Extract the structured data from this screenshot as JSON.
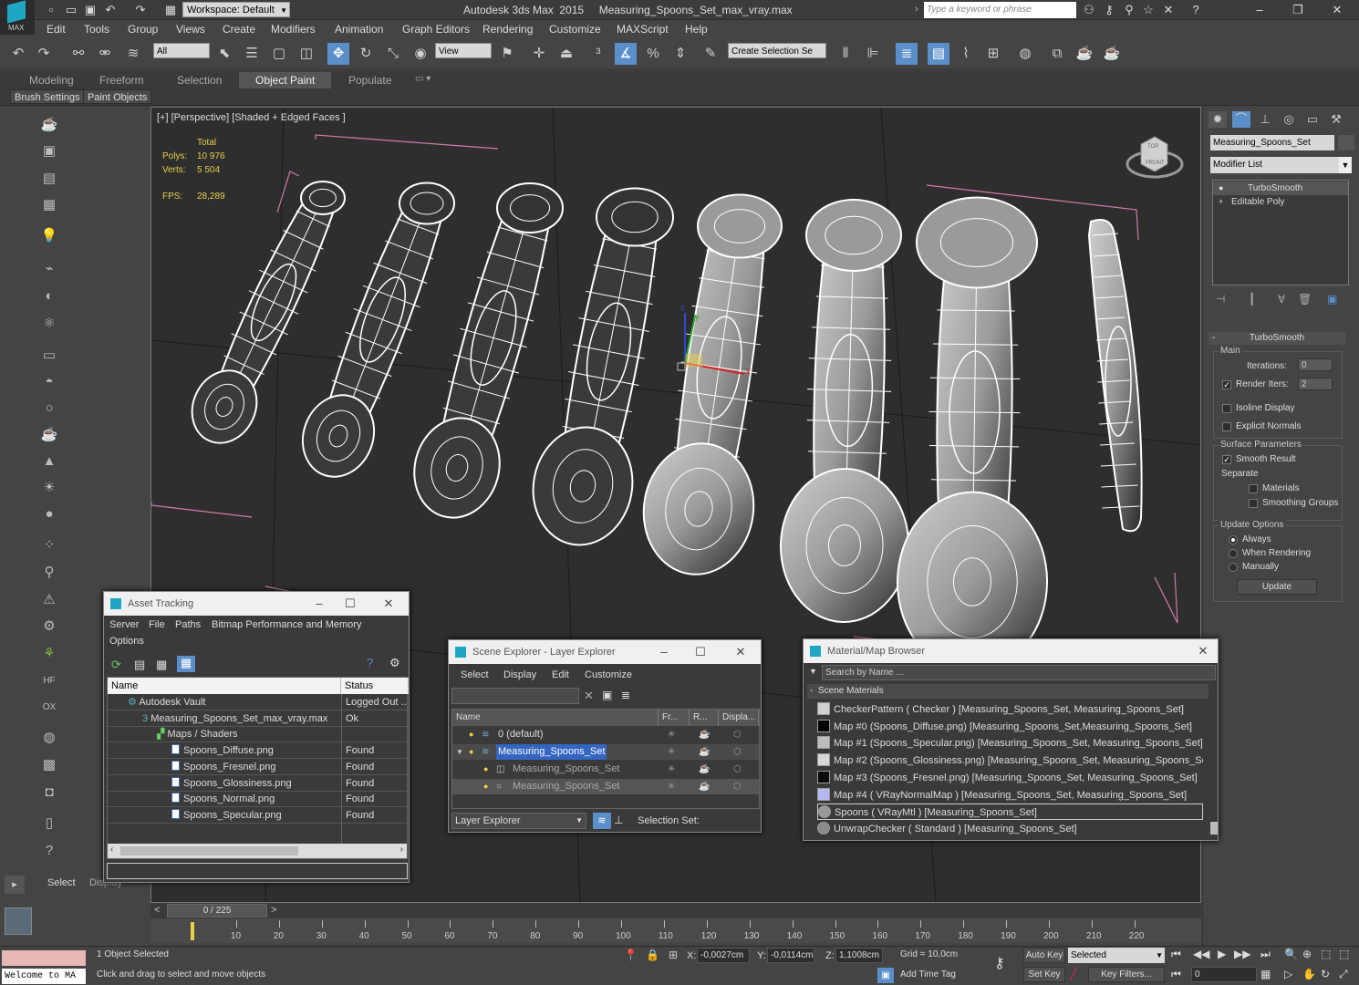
{
  "app": {
    "logo_label": "MAX",
    "workspace": "Workspace: Default",
    "title": "Autodesk 3ds Max  2015     Measuring_Spoons_Set_max_vray.max",
    "search_placeholder": "Type a keyword or phrase"
  },
  "menu": [
    "Edit",
    "Tools",
    "Group",
    "Views",
    "Create",
    "Modifiers",
    "Animation",
    "Graph Editors",
    "Rendering",
    "Customize",
    "MAXScript",
    "Help"
  ],
  "toolbar": {
    "selection_filter": "All",
    "ref_coord": "View",
    "selection_set_placeholder": "Create Selection Se"
  },
  "ribbon": {
    "tabs": [
      "Modeling",
      "Freeform",
      "Selection",
      "Object Paint",
      "Populate"
    ],
    "active_tab": "Object Paint",
    "sub_buttons": [
      "Brush Settings",
      "Paint Objects"
    ]
  },
  "viewport": {
    "label": "[+] [Perspective] [Shaded + Edged Faces ]",
    "stats": {
      "total_label": "Total",
      "polys_label": "Polys:",
      "polys": "10 976",
      "verts_label": "Verts:",
      "verts": "5 504",
      "fps_label": "FPS:",
      "fps": "28,289"
    },
    "gizmo": {
      "x": "x",
      "y": "y",
      "z": "z"
    },
    "viewcube": {
      "top": "TOP",
      "front": "FRONT"
    }
  },
  "command_panel": {
    "object_name": "Measuring_Spoons_Set",
    "modifier_list": "Modifier List",
    "stack": [
      "TurboSmooth",
      "Editable Poly"
    ],
    "rollout_title": "TurboSmooth",
    "main_label": "Main",
    "iterations_label": "Iterations:",
    "iterations": "0",
    "render_iters_label": "Render Iters:",
    "render_iters": "2",
    "isoline_display": "Isoline Display",
    "explicit_normals": "Explicit Normals",
    "surface_params": "Surface Parameters",
    "smooth_result": "Smooth Result",
    "separate": "Separate",
    "materials": "Materials",
    "smoothing_groups": "Smoothing Groups",
    "update_options": "Update Options",
    "always": "Always",
    "when_rendering": "When Rendering",
    "manually": "Manually",
    "update_button": "Update"
  },
  "asset_tracking": {
    "title": "Asset Tracking",
    "menu": [
      "Server",
      "File",
      "Paths",
      "Bitmap Performance and Memory",
      "Options"
    ],
    "columns": [
      "Name",
      "Status"
    ],
    "rows": [
      {
        "name": "Autodesk Vault",
        "status": "Logged Out ..."
      },
      {
        "name": "Measuring_Spoons_Set_max_vray.max",
        "status": "Ok"
      },
      {
        "name": "Maps / Shaders",
        "status": ""
      },
      {
        "name": "Spoons_Diffuse.png",
        "status": "Found"
      },
      {
        "name": "Spoons_Fresnel.png",
        "status": "Found"
      },
      {
        "name": "Spoons_Glossiness.png",
        "status": "Found"
      },
      {
        "name": "Spoons_Normal.png",
        "status": "Found"
      },
      {
        "name": "Spoons_Specular.png",
        "status": "Found"
      }
    ]
  },
  "scene_explorer": {
    "title": "Scene Explorer - Layer Explorer",
    "menu": [
      "Select",
      "Display",
      "Edit",
      "Customize"
    ],
    "columns": [
      "Name",
      "Fr...",
      "R...",
      "Displa..."
    ],
    "rows": [
      {
        "name": "0 (default)"
      },
      {
        "name": "Measuring_Spoons_Set"
      },
      {
        "name": "Measuring_Spoons_Set"
      },
      {
        "name": "Measuring_Spoons_Set"
      }
    ],
    "footer_dropdown": "Layer Explorer",
    "selection_set_label": "Selection Set:"
  },
  "material_browser": {
    "title": "Material/Map Browser",
    "search_placeholder": "Search by Name ...",
    "group": "Scene Materials",
    "items": [
      {
        "label": "CheckerPattern  ( Checker )  [Measuring_Spoons_Set, Measuring_Spoons_Set]",
        "swatch": "#cfcfcf"
      },
      {
        "label": "Map #0 (Spoons_Diffuse.png) [Measuring_Spoons_Set,Measuring_Spoons_Set]",
        "swatch": "#050505"
      },
      {
        "label": "Map #1 (Spoons_Specular.png) [Measuring_Spoons_Set, Measuring_Spoons_Set]",
        "swatch": "#bdbdbd"
      },
      {
        "label": "Map #2 (Spoons_Glossiness.png) [Measuring_Spoons_Set, Measuring_Spoons_Set]",
        "swatch": "#d6d6d6"
      },
      {
        "label": "Map #3 (Spoons_Fresnel.png) [Measuring_Spoons_Set, Measuring_Spoons_Set]",
        "swatch": "#0a0a0a"
      },
      {
        "label": "Map #4  ( VRayNormalMap )  [Measuring_Spoons_Set, Measuring_Spoons_Set]",
        "swatch": "#b8b8f0"
      },
      {
        "label": "Spoons  ( VRayMtl )  [Measuring_Spoons_Set]",
        "swatch": "#9a9a9a"
      },
      {
        "label": "UnwrapChecker  ( Standard )  [Measuring_Spoons_Set]",
        "swatch": "#8a8a8a"
      }
    ]
  },
  "left_panel": {
    "select": "Select",
    "display": "Display"
  },
  "timeline": {
    "frame": "0 / 225",
    "ticks": [
      "0",
      "10",
      "20",
      "30",
      "40",
      "50",
      "60",
      "70",
      "80",
      "90",
      "100",
      "110",
      "120",
      "130",
      "140",
      "150",
      "160",
      "170",
      "180",
      "190",
      "200",
      "210",
      "220"
    ]
  },
  "status": {
    "welcome": "Welcome to MA",
    "selected": "1 Object Selected",
    "prompt": "Click and drag to select and move objects",
    "x_label": "X:",
    "x": "-0,0027cm",
    "y_label": "Y:",
    "y": "-0,0114cm",
    "z_label": "Z:",
    "z": "1,1008cm",
    "grid": "Grid = 10,0cm",
    "add_time_tag": "Add Time Tag",
    "auto_key": "Auto Key",
    "set_key": "Set Key",
    "selected_dd": "Selected",
    "key_filters": "Key Filters...",
    "current_frame": "0"
  },
  "colors": {
    "accent": "#5b8fc9",
    "viewport_bg": "#2e2e2e",
    "wire": "#ffffff",
    "grid_pink": "#d27aa8",
    "stat_yellow": "#e6d04a"
  }
}
